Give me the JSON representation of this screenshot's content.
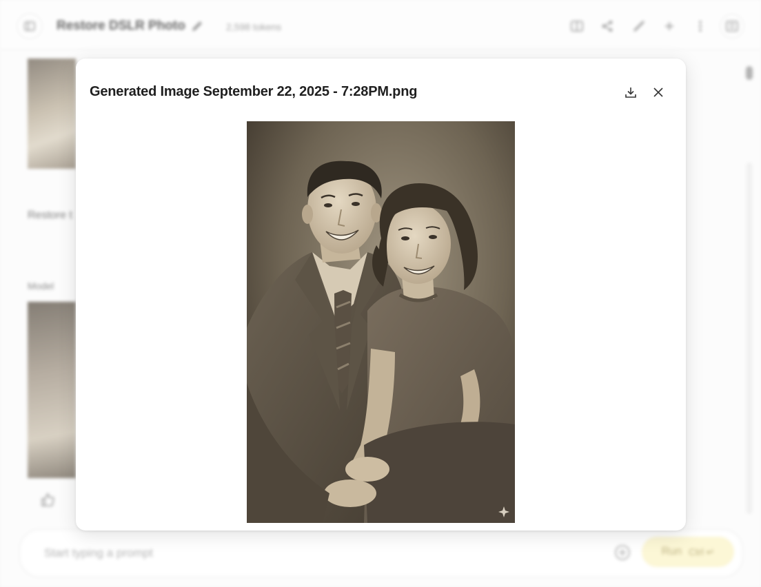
{
  "header": {
    "title": "Restore DSLR Photo",
    "tokens": "2,598 tokens"
  },
  "chat": {
    "user_prompt_partial": "Restore t",
    "model_label": "Model"
  },
  "prompt": {
    "placeholder": "Start typing a prompt",
    "run_label": "Run",
    "run_shortcut": "Ctrl ↵"
  },
  "modal": {
    "title": "Generated Image September 22, 2025 - 7:28PM.png",
    "download_icon": "download-icon",
    "close_icon": "close-icon",
    "image_alt": "Restored vintage sepia portrait of a smiling couple"
  },
  "colors": {
    "run_button_bg": "#fbf4c8",
    "sepia_dark": "#3e362c",
    "sepia_light": "#d9cdb6"
  }
}
